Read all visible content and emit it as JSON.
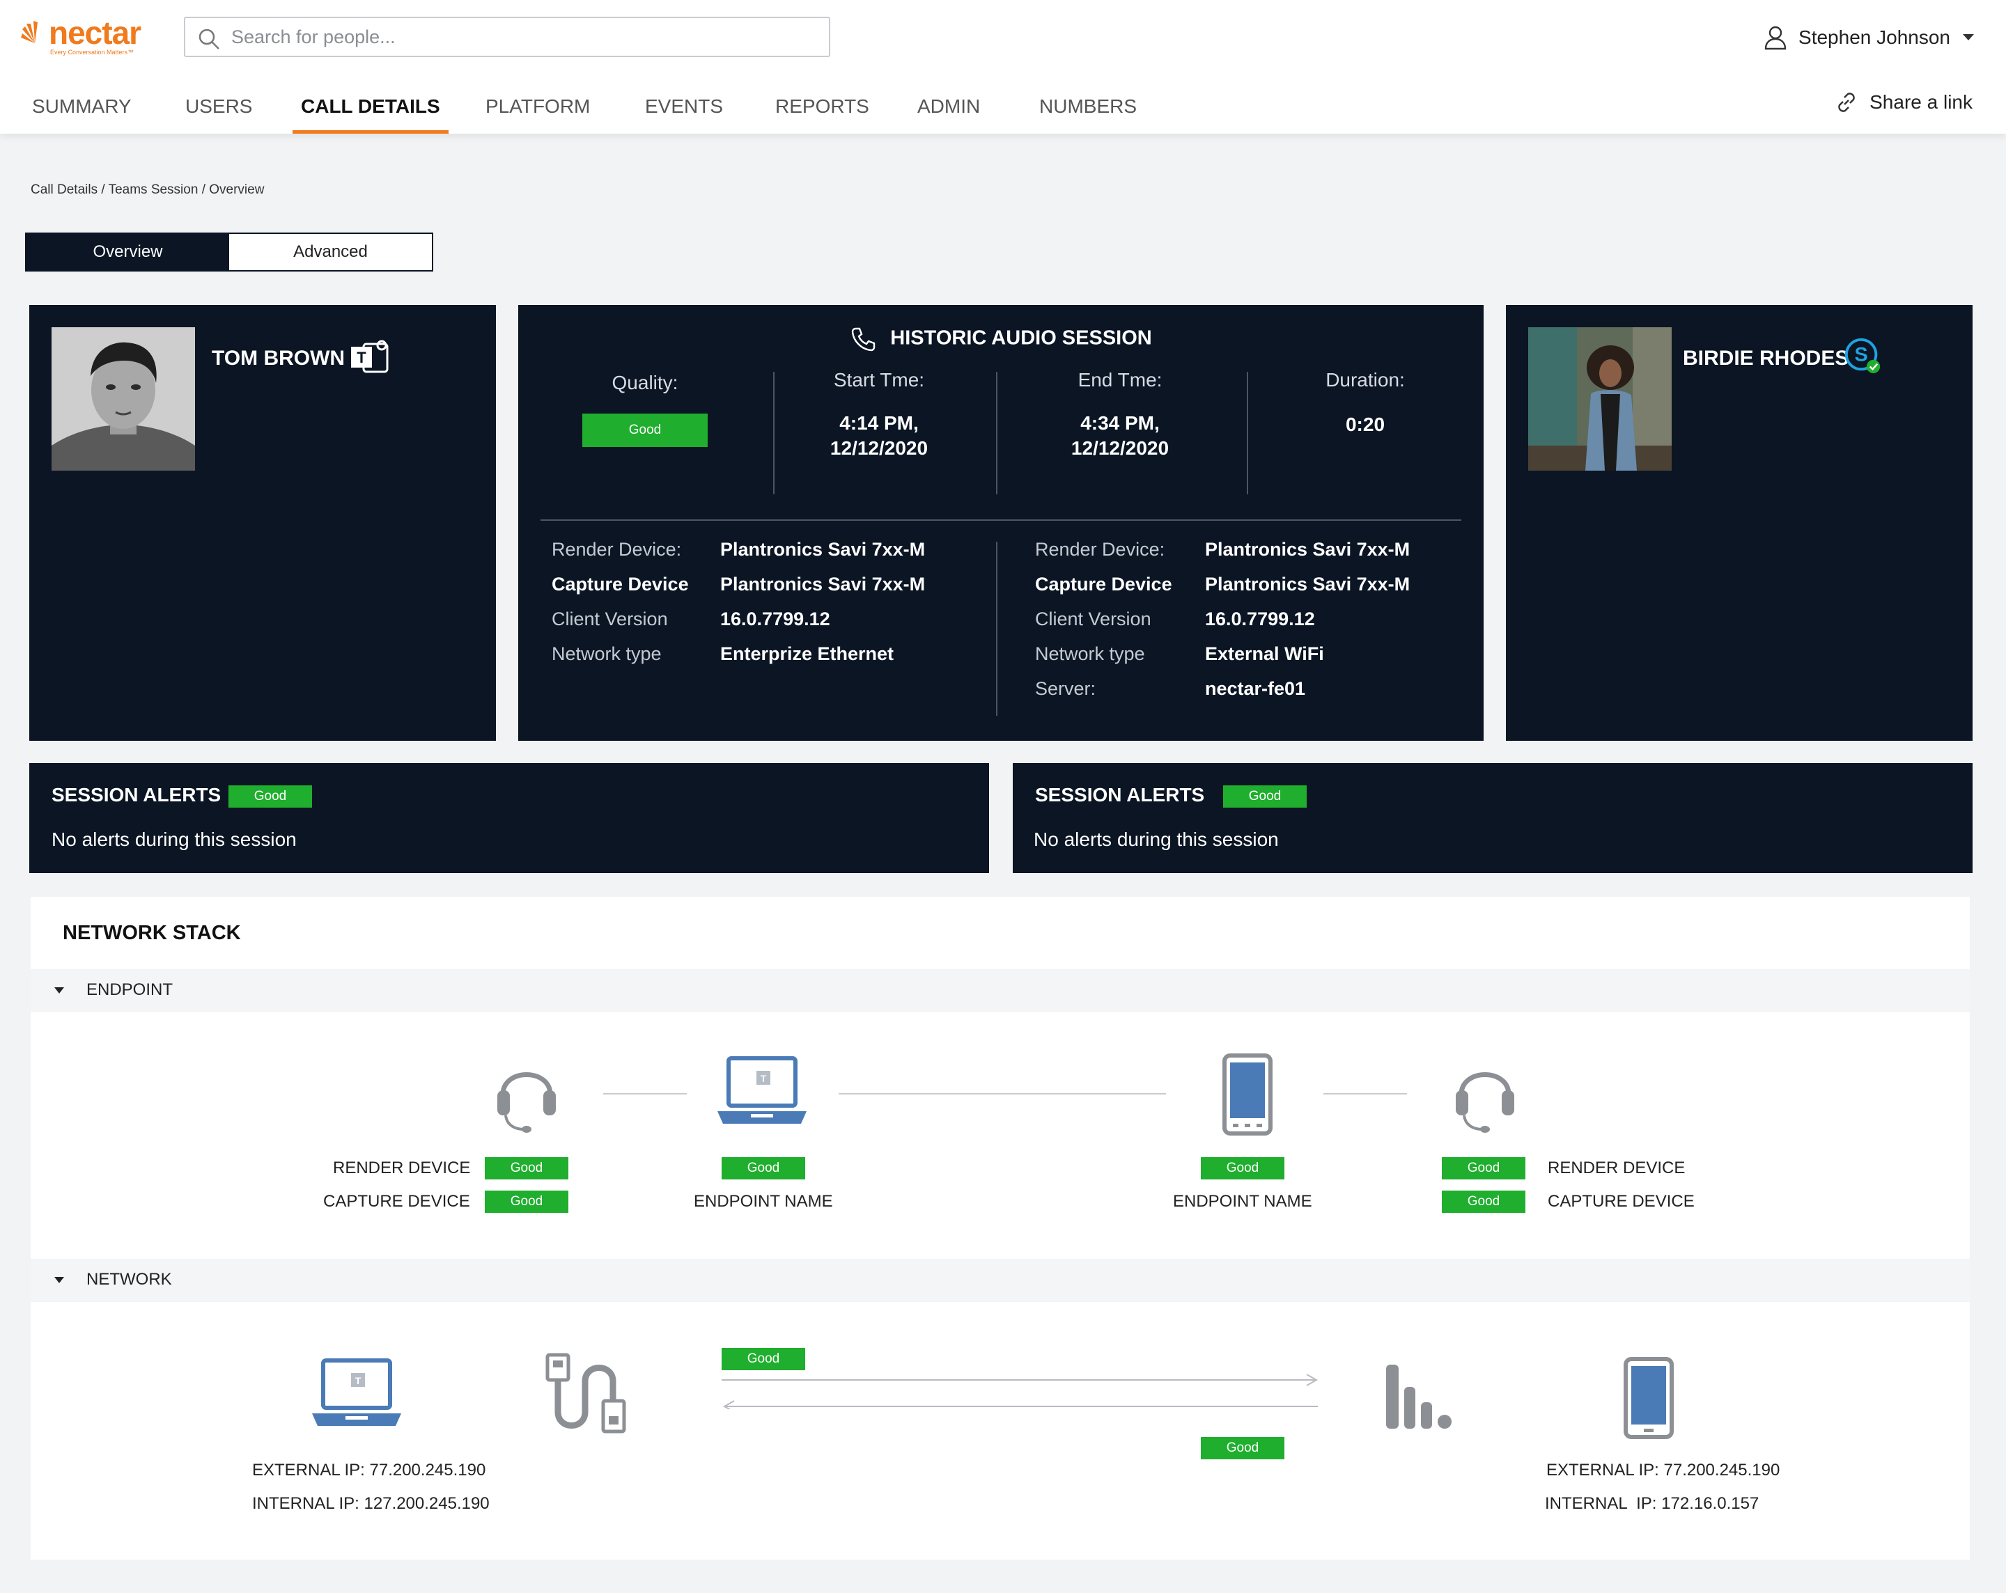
{
  "brand": {
    "name": "nectar",
    "tagline": "Every Conversation Matters™",
    "accent": "#f07a1c"
  },
  "search": {
    "placeholder": "Search for people..."
  },
  "user": {
    "name": "Stephen Johnson"
  },
  "nav": {
    "tabs": [
      "SUMMARY",
      "USERS",
      "CALL DETAILS",
      "PLATFORM",
      "EVENTS",
      "REPORTS",
      "ADMIN",
      "NUMBERS"
    ],
    "active": "CALL DETAILS",
    "share_label": "Share a link"
  },
  "breadcrumb": "Call Details / Teams Session / Overview",
  "view_toggle": {
    "overview": "Overview",
    "advanced": "Advanced",
    "active": "Overview"
  },
  "caller": {
    "name": "TOM BROWN",
    "app_icon": "teams-icon"
  },
  "callee": {
    "name": "BIRDIE RHODES",
    "app_icon": "skype-icon"
  },
  "session": {
    "title": "HISTORIC AUDIO SESSION",
    "quality_label": "Quality:",
    "quality_value": "Good",
    "start_label": "Start Tme:",
    "start_time": "4:14 PM,",
    "start_date": "12/12/2020",
    "end_label": "End Tme:",
    "end_time": "4:34 PM,",
    "end_date": "12/12/2020",
    "duration_label": "Duration:",
    "duration_value": "0:20",
    "left_details": [
      {
        "key": "Render Device:",
        "value": "Plantronics Savi 7xx-M"
      },
      {
        "key": "Capture Device",
        "value": "Plantronics Savi 7xx-M"
      },
      {
        "key": "Client Version",
        "value": "16.0.7799.12"
      },
      {
        "key": "Network type",
        "value": "Enterprize Ethernet"
      }
    ],
    "right_details": [
      {
        "key": "Render Device:",
        "value": "Plantronics Savi 7xx-M"
      },
      {
        "key": "Capture Device",
        "value": "Plantronics Savi 7xx-M"
      },
      {
        "key": "Client Version",
        "value": "16.0.7799.12"
      },
      {
        "key": "Network type",
        "value": "External WiFi"
      },
      {
        "key": "Server:",
        "value": "nectar-fe01"
      }
    ]
  },
  "alerts_left": {
    "title": "SESSION ALERTS",
    "status": "Good",
    "message": "No alerts during this session"
  },
  "alerts_right": {
    "title": "SESSION ALERTS",
    "status": "Good",
    "message": "No alerts during this session"
  },
  "network_stack": {
    "title": "NETWORK STACK",
    "endpoint_section": "ENDPOINT",
    "network_section": "NETWORK",
    "good": "Good",
    "render_device": "RENDER DEVICE",
    "capture_device": "CAPTURE DEVICE",
    "endpoint_name": "ENDPOINT NAME",
    "left_external_ip": "EXTERNAL IP: 77.200.245.190",
    "left_internal_ip": "INTERNAL IP: 127.200.245.190",
    "right_external_ip": "EXTERNAL IP: 77.200.245.190",
    "right_internal_ip": "INTERNAL  IP: 172.16.0.157"
  },
  "colors": {
    "dark_panel": "#0b1524",
    "good": "#1fae2d",
    "device_blue": "#4a7bb7",
    "icon_gray": "#8c8f94"
  }
}
